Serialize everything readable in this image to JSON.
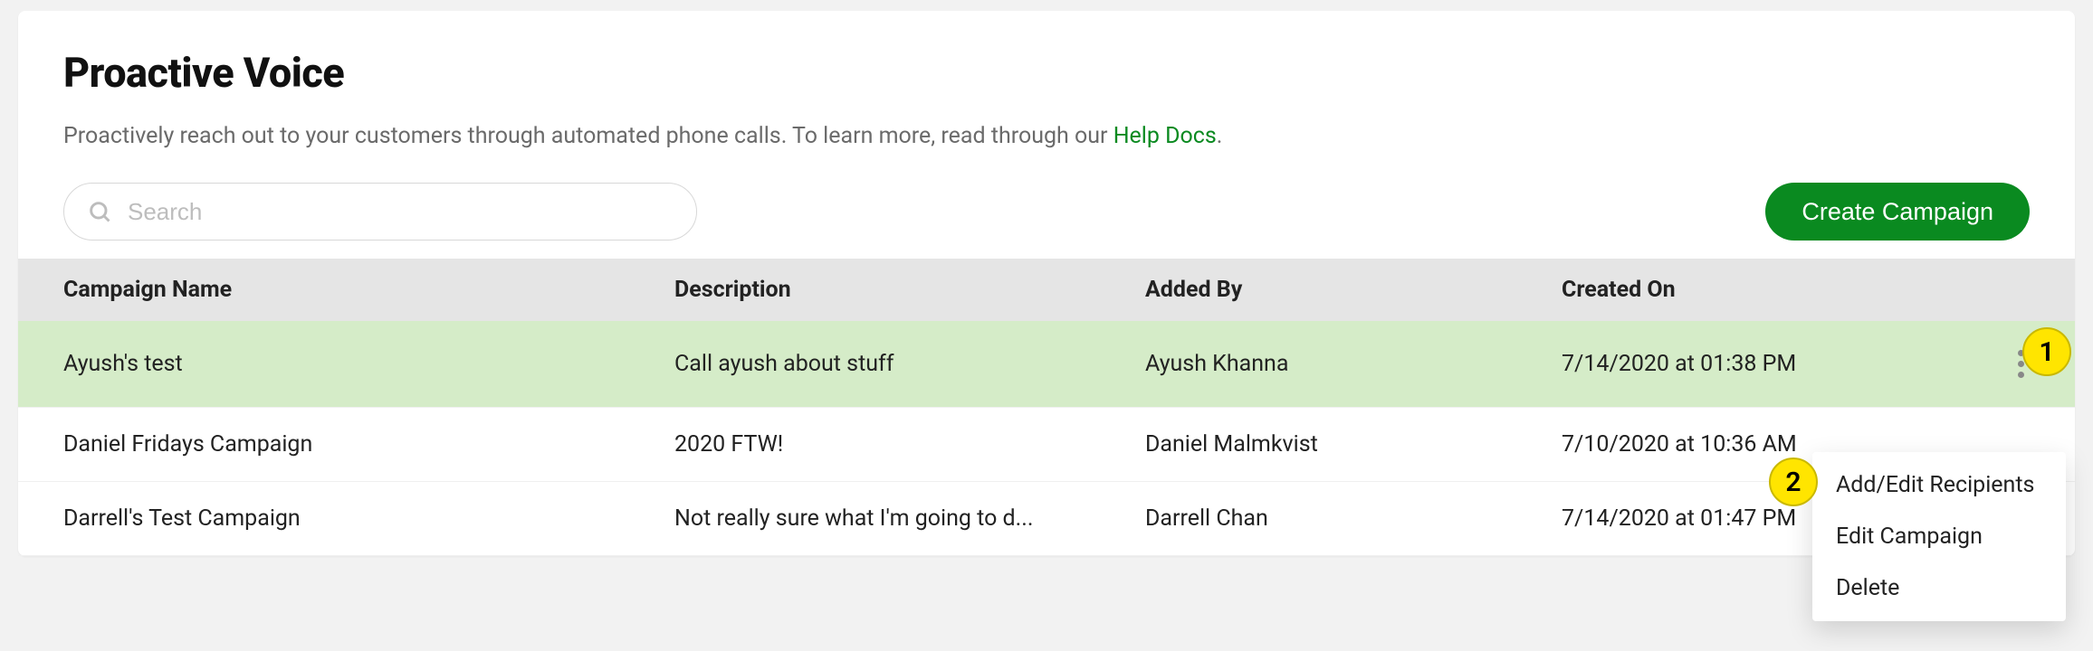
{
  "header": {
    "title": "Proactive Voice",
    "subtitle_prefix": "Proactively reach out to your customers through automated phone calls. To learn more, read through our ",
    "help_link_label": "Help Docs",
    "subtitle_suffix": "."
  },
  "search": {
    "placeholder": "Search",
    "value": ""
  },
  "create_button": "Create Campaign",
  "columns": {
    "name": "Campaign Name",
    "description": "Description",
    "added_by": "Added By",
    "created_on": "Created On"
  },
  "rows": [
    {
      "name": "Ayush's test",
      "description": "Call ayush about stuff",
      "added_by": "Ayush Khanna",
      "created_on": "7/14/2020 at 01:38 PM",
      "highlight": true
    },
    {
      "name": "Daniel Fridays Campaign",
      "description": "2020 FTW!",
      "added_by": "Daniel Malmkvist",
      "created_on": "7/10/2020 at 10:36 AM",
      "highlight": false
    },
    {
      "name": "Darrell's Test Campaign",
      "description": "Not really sure what I'm going to d...",
      "added_by": "Darrell Chan",
      "created_on": "7/14/2020 at 01:47 PM",
      "highlight": false
    }
  ],
  "dropdown": {
    "add_edit": "Add/Edit Recipients",
    "edit": "Edit Campaign",
    "delete": "Delete"
  },
  "callouts": {
    "one": "1",
    "two": "2"
  }
}
